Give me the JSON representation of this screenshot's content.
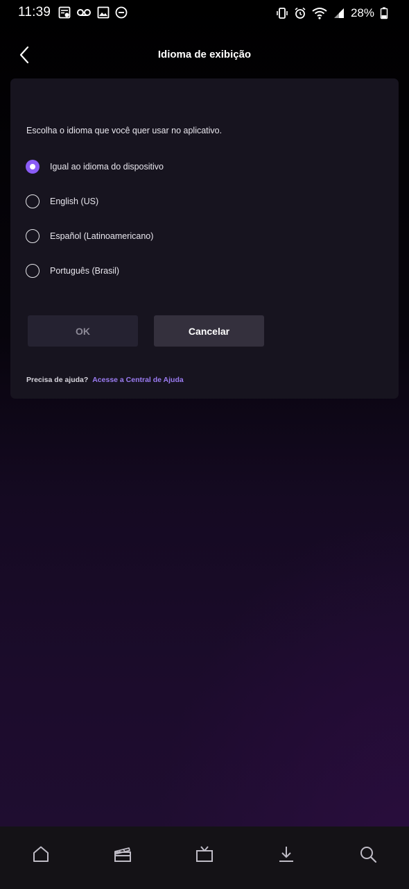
{
  "status_bar": {
    "time": "11:39",
    "battery": "28%",
    "left_icons": [
      "sim-card-icon",
      "voicemail-icon",
      "image-icon",
      "do-not-disturb-icon"
    ],
    "right_icons": [
      "vibrate-icon",
      "alarm-icon",
      "wifi-icon",
      "signal-icon",
      "battery-icon"
    ]
  },
  "header": {
    "title": "Idioma de exibição",
    "back_icon": "chevron-left-icon"
  },
  "language_card": {
    "description": "Escolha o idioma que você quer usar no aplicativo.",
    "options": [
      {
        "label": "Igual ao idioma do dispositivo",
        "selected": true
      },
      {
        "label": "English (US)",
        "selected": false
      },
      {
        "label": "Español (Latinoamericano)",
        "selected": false
      },
      {
        "label": "Português (Brasil)",
        "selected": false
      }
    ],
    "ok_label": "OK",
    "cancel_label": "Cancelar",
    "help_text": "Precisa de ajuda?",
    "help_link": "Acesse a Central de Ajuda"
  },
  "bottom_nav": {
    "items": [
      "home-icon",
      "movies-icon",
      "tv-icon",
      "download-icon",
      "search-icon"
    ]
  },
  "colors": {
    "accent": "#8a5cf6",
    "link": "#9b7cf2",
    "card_bg": "#17141f",
    "nav_bg": "#141216"
  }
}
